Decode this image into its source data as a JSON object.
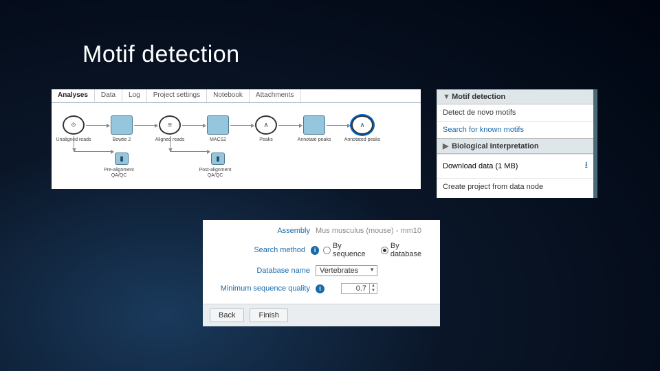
{
  "title": "Motif detection",
  "pipeline": {
    "tabs": [
      "Analyses",
      "Data",
      "Log",
      "Project settings",
      "Notebook",
      "Attachments"
    ],
    "active_tab": 0,
    "nodes": {
      "unaligned": "Unaligned reads",
      "bowtie": "Bowtie 2",
      "aligned": "Aligned reads",
      "macs2": "MACS2",
      "peaks": "Peaks",
      "annotate": "Annotate peaks",
      "annotated": "Annotated peaks",
      "preqc": "Pre-alignment QA/QC",
      "postqc": "Post-alignment QA/QC"
    }
  },
  "sidebar": {
    "section_motif": "Motif detection",
    "detect_denovo": "Detect de novo motifs",
    "search_known": "Search for known motifs",
    "section_bio": "Biological Interpretation",
    "download": "Download data (1 MB)",
    "create_project": "Create project from data node"
  },
  "form": {
    "assembly_label": "Assembly",
    "assembly_value": "Mus musculus (mouse) - mm10",
    "search_method_label": "Search method",
    "opt_sequence": "By sequence",
    "opt_database": "By database",
    "database_label": "Database name",
    "database_value": "Vertebrates",
    "min_quality_label": "Minimum sequence quality",
    "min_quality_value": "0.7",
    "back": "Back",
    "finish": "Finish"
  }
}
